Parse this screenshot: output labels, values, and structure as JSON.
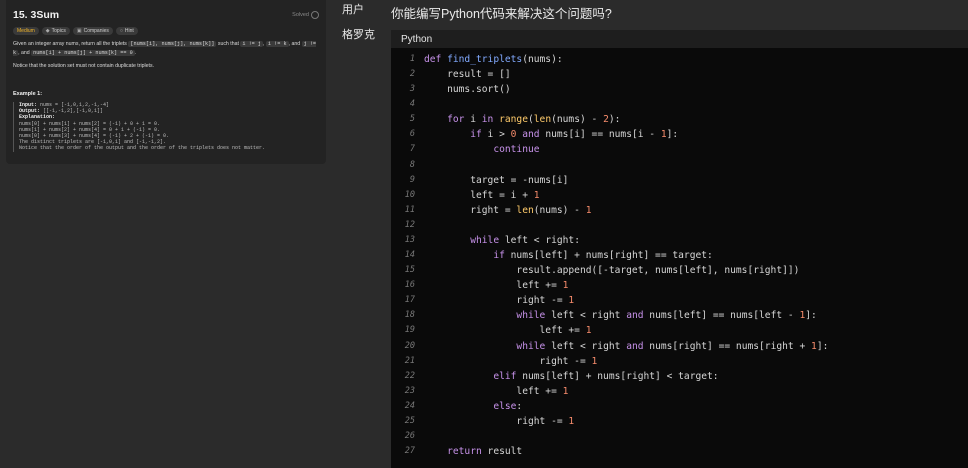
{
  "problem": {
    "title": "15. 3Sum",
    "status": "Solved",
    "tags": [
      {
        "label": "Medium"
      },
      {
        "label": "Topics"
      },
      {
        "label": "Companies"
      },
      {
        "label": "Hint"
      }
    ],
    "desc_p1a": "Given an integer array nums, return all the triplets ",
    "desc_code1": "[nums[i], nums[j], nums[k]]",
    "desc_p1b": " such that ",
    "desc_code2": "i != j",
    "desc_p1c": ", ",
    "desc_code3": "i != k",
    "desc_p1d": ", and ",
    "desc_code4": "j != k",
    "desc_p1e": ", and ",
    "desc_code5": "nums[i] + nums[j] + nums[k] == 0",
    "desc_p1f": ".",
    "note": "Notice that the solution set must not contain duplicate triplets.",
    "example_title": "Example 1:",
    "example": {
      "input_label": "Input:",
      "input_value": " nums = [-1,0,1,2,-1,-4]",
      "output_label": "Output:",
      "output_value": " [[-1,-1,2],[-1,0,1]]",
      "explanation_label": "Explanation:",
      "lines": [
        "nums[0] + nums[1] + nums[2] = (-1) + 0 + 1 = 0.",
        "nums[1] + nums[2] + nums[4] = 0 + 1 + (-1) = 0.",
        "nums[0] + nums[3] + nums[4] = (-1) + 2 + (-1) = 0.",
        "The distinct triplets are [-1,0,1] and [-1,-1,2].",
        "Notice that the order of the output and the order of the triplets does not matter."
      ]
    }
  },
  "chat": {
    "user_label": "用户",
    "assistant_label": "格罗克",
    "question": "你能编写Python代码来解决这个问题吗?"
  },
  "code": {
    "language": "Python",
    "lines": [
      "def find_triplets(nums):",
      "    result = []",
      "    nums.sort()",
      "",
      "    for i in range(len(nums) - 2):",
      "        if i > 0 and nums[i] == nums[i - 1]:",
      "            continue",
      "",
      "        target = -nums[i]",
      "        left = i + 1",
      "        right = len(nums) - 1",
      "",
      "        while left < right:",
      "            if nums[left] + nums[right] == target:",
      "                result.append([-target, nums[left], nums[right]])",
      "                left += 1",
      "                right -= 1",
      "                while left < right and nums[left] == nums[left - 1]:",
      "                    left += 1",
      "                while left < right and nums[right] == nums[right + 1]:",
      "                    right -= 1",
      "            elif nums[left] + nums[right] < target:",
      "                left += 1",
      "            else:",
      "                right -= 1",
      "",
      "    return result"
    ]
  },
  "colors": {
    "keyword": "#c792ea",
    "function": "#82aaff",
    "builtin": "#ffcb6b",
    "number": "#f78c6c",
    "medium_badge": "#f0b429"
  }
}
